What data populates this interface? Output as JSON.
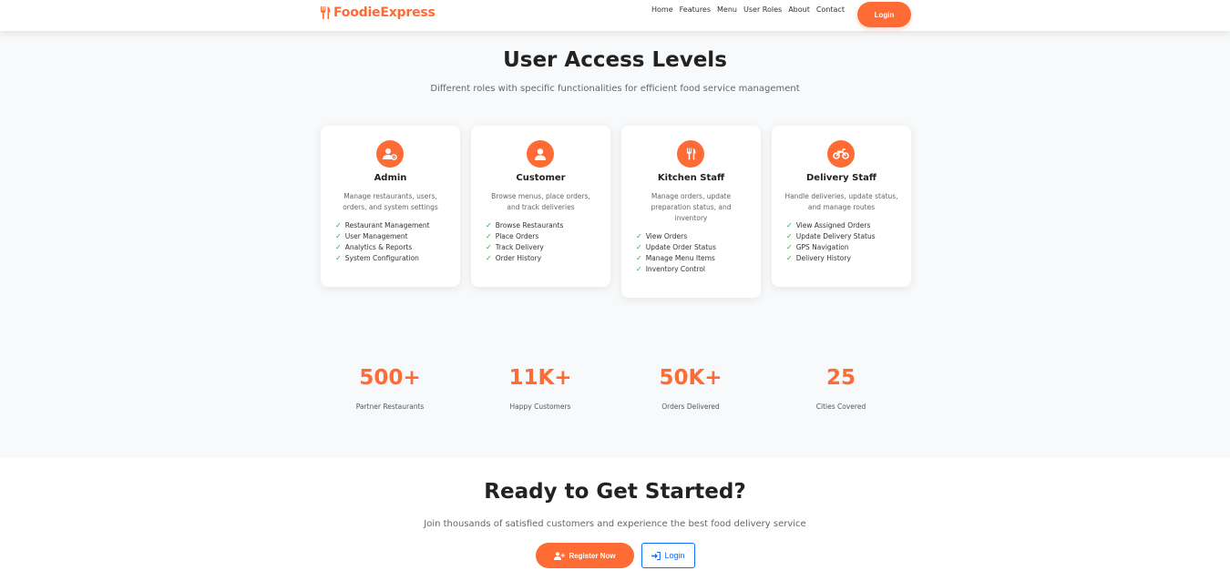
{
  "nav": {
    "brand": "FoodieExpress",
    "links": [
      "Home",
      "Features",
      "Menu",
      "User Roles",
      "About",
      "Contact"
    ],
    "login_label": "Login"
  },
  "roles_section": {
    "title": "User Access Levels",
    "subtitle": "Different roles with specific functionalities for efficient food service management",
    "cards": [
      {
        "name": "Admin",
        "icon": "user-cog-icon",
        "description": "Manage restaurants, users, orders, and system settings",
        "features": [
          "Restaurant Management",
          "User Management",
          "Analytics & Reports",
          "System Configuration"
        ]
      },
      {
        "name": "Customer",
        "icon": "user-icon",
        "description": "Browse menus, place orders, and track deliveries",
        "features": [
          "Browse Restaurants",
          "Place Orders",
          "Track Delivery",
          "Order History"
        ]
      },
      {
        "name": "Kitchen Staff",
        "icon": "utensils-icon",
        "description": "Manage orders, update preparation status, and inventory",
        "features": [
          "View Orders",
          "Update Order Status",
          "Manage Menu Items",
          "Inventory Control"
        ]
      },
      {
        "name": "Delivery Staff",
        "icon": "motorcycle-icon",
        "description": "Handle deliveries, update status, and manage routes",
        "features": [
          "View Assigned Orders",
          "Update Delivery Status",
          "GPS Navigation",
          "Delivery History"
        ]
      }
    ]
  },
  "stats": [
    {
      "value": "500+",
      "label": "Partner Restaurants"
    },
    {
      "value": "11K+",
      "label": "Happy Customers"
    },
    {
      "value": "50K+",
      "label": "Orders Delivered"
    },
    {
      "value": "25",
      "label": "Cities Covered"
    }
  ],
  "cta": {
    "title": "Ready to Get Started?",
    "subtitle": "Join thousands of satisfied customers and experience the best food delivery service",
    "register_label": "Register Now",
    "login_label": "Login"
  },
  "colors": {
    "accent": "#ff6b35",
    "check": "#28a745",
    "link_blue": "#0d6efd"
  }
}
